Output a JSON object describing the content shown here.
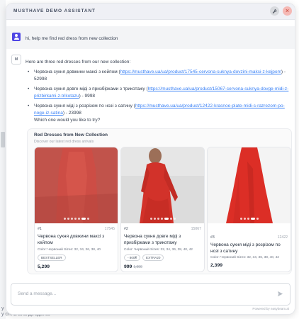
{
  "header": {
    "title": "MUSTHAVE DEMO ASSISTANT"
  },
  "user_message": {
    "text": "hi, help me find red dress from new collection"
  },
  "bot_message": {
    "avatar_label": "M",
    "intro": "Here are three red dresses from our new collection:",
    "items": [
      {
        "name": "Червона сукня довжини максі з кейпом",
        "url": "https://musthave.ua/ua/product/17545-cervona-suknya-dovzini-maksi-z-kejpom",
        "price": "52998"
      },
      {
        "name": "Червона сукня довге міді з призбірками з трикотажу",
        "url": "https://musthave.ua/ua/product/15067-cervona-suknya-dovge-midi-z-prizbirkami-z-trikotazu",
        "price": "9998"
      },
      {
        "name": "Червона сукня міді з розрізом по нозі з сатину",
        "url": "https://musthave.ua/ua/product/12422-krasnoe-plate-midi-s-razrezom-po-noge-iz-satina",
        "price": "23998"
      }
    ],
    "question": "Which one would you like to try?"
  },
  "product_panel": {
    "title": "Red Dresses from New Collection",
    "subtitle": "Discover our latest red dress arrivals",
    "products": [
      {
        "index": "#1",
        "id": "17545",
        "name": "Червона сукня довжини максі з кейпом",
        "meta": "Color: Червоний  Sizes: 32, 34, 36, 38, 40",
        "tags": [
          "BESTSELLER"
        ],
        "price": "5,299",
        "old_price": ""
      },
      {
        "index": "#2",
        "id": "15067",
        "name": "Червона сукня довге міді з призбірками з трикотажу",
        "meta": "Color: Червоний  Sizes: 32, 34, 36, 38, 40, 42",
        "tags": [
          "- 800₴",
          "EXTRA20"
        ],
        "price": "999",
        "old_price": "1,999"
      },
      {
        "index": "#3",
        "id": "12422",
        "name": "Червона сукня міді з розрізом по нозі з сатину",
        "meta": "Color: Червоний  Sizes: 32, 34, 36, 38, 40, 42",
        "tags": [],
        "price": "2,399",
        "old_price": ""
      }
    ]
  },
  "composer": {
    "placeholder": "Send a message...",
    "powered_by": "Powered by easybeam.ai"
  },
  "background": {
    "footer_fragment": "у  сітна Бла Дігедатка",
    "footer_fragment_top": "у"
  },
  "icons": {
    "tool": "wrench-icon",
    "close": "close-icon",
    "user": "user-icon",
    "send": "send-icon"
  },
  "colors": {
    "accent": "#4f46e5",
    "link": "#3b82f6",
    "close_bg": "#f5b8b4",
    "header_bg": "#eff0f5"
  }
}
